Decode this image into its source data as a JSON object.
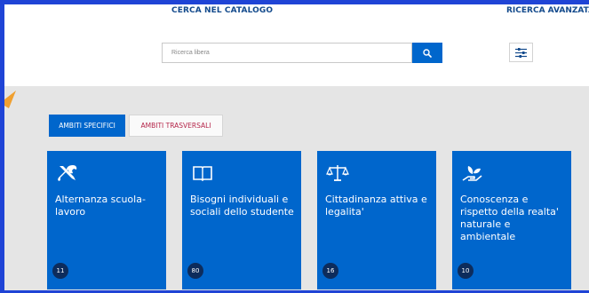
{
  "search": {
    "title": "CERCA NEL CATALOGO",
    "placeholder": "Ricerca libera",
    "button_icon": "search-icon"
  },
  "advanced": {
    "label": "RICERCA AVANZATA",
    "icon": "sliders-icon"
  },
  "tabs": [
    {
      "label": "AMBITI SPECIFICI",
      "active": true
    },
    {
      "label": "AMBITI TRASVERSALI",
      "active": false
    }
  ],
  "cards": [
    {
      "icon": "tools-icon",
      "title": "Alternanza scuola-lavoro",
      "count": "11"
    },
    {
      "icon": "book-icon",
      "title": "Bisogni individuali e sociali dello studente",
      "count": "80"
    },
    {
      "icon": "scales-icon",
      "title": "Cittadinanza attiva e legalita'",
      "count": "16"
    },
    {
      "icon": "plant-hand-icon",
      "title": "Conoscenza e rispetto della realta' naturale e ambientale",
      "count": "10"
    }
  ],
  "colors": {
    "accent": "#0066cc",
    "frame": "#1f44d6",
    "heading": "#134a8c",
    "tab_inactive_text": "#b5264a",
    "badge": "#0d2c5c",
    "background": "#e5e5e5"
  }
}
